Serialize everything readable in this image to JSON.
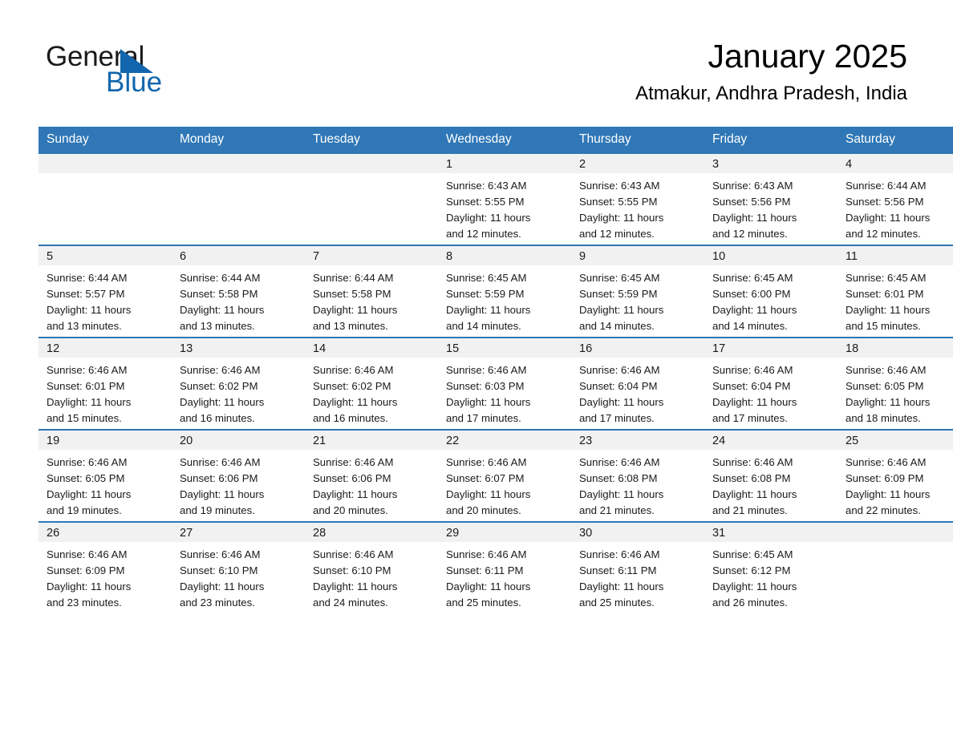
{
  "brand": {
    "name_part1": "General",
    "name_part2": "Blue",
    "accent_color": "#1266ad",
    "triangle_icon": "triangle-icon"
  },
  "header": {
    "title": "January 2025",
    "subtitle": "Atmakur, Andhra Pradesh, India"
  },
  "calendar": {
    "header_bg": "#2f77b6",
    "daynum_bg": "#f1f1f1",
    "columns": [
      "Sunday",
      "Monday",
      "Tuesday",
      "Wednesday",
      "Thursday",
      "Friday",
      "Saturday"
    ],
    "weeks": [
      [
        {
          "day": "",
          "empty": true
        },
        {
          "day": "",
          "empty": true
        },
        {
          "day": "",
          "empty": true
        },
        {
          "day": "1",
          "sunrise": "Sunrise: 6:43 AM",
          "sunset": "Sunset: 5:55 PM",
          "daylight1": "Daylight: 11 hours",
          "daylight2": "and 12 minutes."
        },
        {
          "day": "2",
          "sunrise": "Sunrise: 6:43 AM",
          "sunset": "Sunset: 5:55 PM",
          "daylight1": "Daylight: 11 hours",
          "daylight2": "and 12 minutes."
        },
        {
          "day": "3",
          "sunrise": "Sunrise: 6:43 AM",
          "sunset": "Sunset: 5:56 PM",
          "daylight1": "Daylight: 11 hours",
          "daylight2": "and 12 minutes."
        },
        {
          "day": "4",
          "sunrise": "Sunrise: 6:44 AM",
          "sunset": "Sunset: 5:56 PM",
          "daylight1": "Daylight: 11 hours",
          "daylight2": "and 12 minutes."
        }
      ],
      [
        {
          "day": "5",
          "sunrise": "Sunrise: 6:44 AM",
          "sunset": "Sunset: 5:57 PM",
          "daylight1": "Daylight: 11 hours",
          "daylight2": "and 13 minutes."
        },
        {
          "day": "6",
          "sunrise": "Sunrise: 6:44 AM",
          "sunset": "Sunset: 5:58 PM",
          "daylight1": "Daylight: 11 hours",
          "daylight2": "and 13 minutes."
        },
        {
          "day": "7",
          "sunrise": "Sunrise: 6:44 AM",
          "sunset": "Sunset: 5:58 PM",
          "daylight1": "Daylight: 11 hours",
          "daylight2": "and 13 minutes."
        },
        {
          "day": "8",
          "sunrise": "Sunrise: 6:45 AM",
          "sunset": "Sunset: 5:59 PM",
          "daylight1": "Daylight: 11 hours",
          "daylight2": "and 14 minutes."
        },
        {
          "day": "9",
          "sunrise": "Sunrise: 6:45 AM",
          "sunset": "Sunset: 5:59 PM",
          "daylight1": "Daylight: 11 hours",
          "daylight2": "and 14 minutes."
        },
        {
          "day": "10",
          "sunrise": "Sunrise: 6:45 AM",
          "sunset": "Sunset: 6:00 PM",
          "daylight1": "Daylight: 11 hours",
          "daylight2": "and 14 minutes."
        },
        {
          "day": "11",
          "sunrise": "Sunrise: 6:45 AM",
          "sunset": "Sunset: 6:01 PM",
          "daylight1": "Daylight: 11 hours",
          "daylight2": "and 15 minutes."
        }
      ],
      [
        {
          "day": "12",
          "sunrise": "Sunrise: 6:46 AM",
          "sunset": "Sunset: 6:01 PM",
          "daylight1": "Daylight: 11 hours",
          "daylight2": "and 15 minutes."
        },
        {
          "day": "13",
          "sunrise": "Sunrise: 6:46 AM",
          "sunset": "Sunset: 6:02 PM",
          "daylight1": "Daylight: 11 hours",
          "daylight2": "and 16 minutes."
        },
        {
          "day": "14",
          "sunrise": "Sunrise: 6:46 AM",
          "sunset": "Sunset: 6:02 PM",
          "daylight1": "Daylight: 11 hours",
          "daylight2": "and 16 minutes."
        },
        {
          "day": "15",
          "sunrise": "Sunrise: 6:46 AM",
          "sunset": "Sunset: 6:03 PM",
          "daylight1": "Daylight: 11 hours",
          "daylight2": "and 17 minutes."
        },
        {
          "day": "16",
          "sunrise": "Sunrise: 6:46 AM",
          "sunset": "Sunset: 6:04 PM",
          "daylight1": "Daylight: 11 hours",
          "daylight2": "and 17 minutes."
        },
        {
          "day": "17",
          "sunrise": "Sunrise: 6:46 AM",
          "sunset": "Sunset: 6:04 PM",
          "daylight1": "Daylight: 11 hours",
          "daylight2": "and 17 minutes."
        },
        {
          "day": "18",
          "sunrise": "Sunrise: 6:46 AM",
          "sunset": "Sunset: 6:05 PM",
          "daylight1": "Daylight: 11 hours",
          "daylight2": "and 18 minutes."
        }
      ],
      [
        {
          "day": "19",
          "sunrise": "Sunrise: 6:46 AM",
          "sunset": "Sunset: 6:05 PM",
          "daylight1": "Daylight: 11 hours",
          "daylight2": "and 19 minutes."
        },
        {
          "day": "20",
          "sunrise": "Sunrise: 6:46 AM",
          "sunset": "Sunset: 6:06 PM",
          "daylight1": "Daylight: 11 hours",
          "daylight2": "and 19 minutes."
        },
        {
          "day": "21",
          "sunrise": "Sunrise: 6:46 AM",
          "sunset": "Sunset: 6:06 PM",
          "daylight1": "Daylight: 11 hours",
          "daylight2": "and 20 minutes."
        },
        {
          "day": "22",
          "sunrise": "Sunrise: 6:46 AM",
          "sunset": "Sunset: 6:07 PM",
          "daylight1": "Daylight: 11 hours",
          "daylight2": "and 20 minutes."
        },
        {
          "day": "23",
          "sunrise": "Sunrise: 6:46 AM",
          "sunset": "Sunset: 6:08 PM",
          "daylight1": "Daylight: 11 hours",
          "daylight2": "and 21 minutes."
        },
        {
          "day": "24",
          "sunrise": "Sunrise: 6:46 AM",
          "sunset": "Sunset: 6:08 PM",
          "daylight1": "Daylight: 11 hours",
          "daylight2": "and 21 minutes."
        },
        {
          "day": "25",
          "sunrise": "Sunrise: 6:46 AM",
          "sunset": "Sunset: 6:09 PM",
          "daylight1": "Daylight: 11 hours",
          "daylight2": "and 22 minutes."
        }
      ],
      [
        {
          "day": "26",
          "sunrise": "Sunrise: 6:46 AM",
          "sunset": "Sunset: 6:09 PM",
          "daylight1": "Daylight: 11 hours",
          "daylight2": "and 23 minutes."
        },
        {
          "day": "27",
          "sunrise": "Sunrise: 6:46 AM",
          "sunset": "Sunset: 6:10 PM",
          "daylight1": "Daylight: 11 hours",
          "daylight2": "and 23 minutes."
        },
        {
          "day": "28",
          "sunrise": "Sunrise: 6:46 AM",
          "sunset": "Sunset: 6:10 PM",
          "daylight1": "Daylight: 11 hours",
          "daylight2": "and 24 minutes."
        },
        {
          "day": "29",
          "sunrise": "Sunrise: 6:46 AM",
          "sunset": "Sunset: 6:11 PM",
          "daylight1": "Daylight: 11 hours",
          "daylight2": "and 25 minutes."
        },
        {
          "day": "30",
          "sunrise": "Sunrise: 6:46 AM",
          "sunset": "Sunset: 6:11 PM",
          "daylight1": "Daylight: 11 hours",
          "daylight2": "and 25 minutes."
        },
        {
          "day": "31",
          "sunrise": "Sunrise: 6:45 AM",
          "sunset": "Sunset: 6:12 PM",
          "daylight1": "Daylight: 11 hours",
          "daylight2": "and 26 minutes."
        },
        {
          "day": "",
          "empty": true
        }
      ]
    ]
  }
}
